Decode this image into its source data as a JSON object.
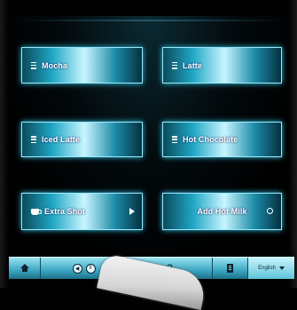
{
  "tiles": [
    {
      "label": "Mocha",
      "icon": "menu-icon"
    },
    {
      "label": "Latte",
      "icon": "menu-icon"
    },
    {
      "label": "Iced Latte",
      "icon": "menu-icon"
    },
    {
      "label": "Hot Chocolate",
      "icon": "menu-icon"
    },
    {
      "label": "Extra Shot",
      "icon": "cup-icon",
      "trailing_icon": "play-icon"
    },
    {
      "label": "Add Hot Milk",
      "trailing_icon": "ring-icon"
    }
  ],
  "bottom_bar": {
    "nav_left": "◀",
    "nav_right": "II",
    "help": "?",
    "language": "English"
  },
  "colors": {
    "accent": "#1fa6c4",
    "highlight": "#c8f6ff",
    "background": "#000000"
  }
}
